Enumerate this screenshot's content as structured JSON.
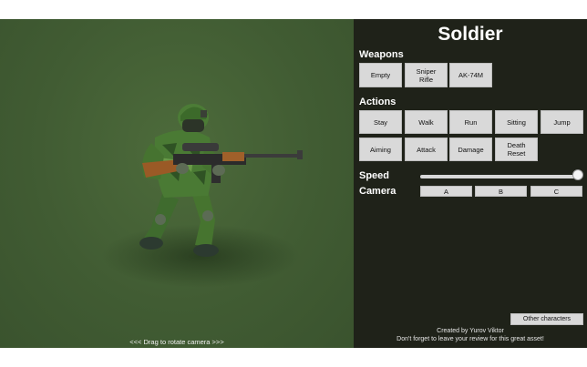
{
  "viewport": {
    "drag_hint": "<<< Drag to rotate camera >>>"
  },
  "panel": {
    "title": "Soldier",
    "weapons_label": "Weapons",
    "weapons": [
      "Empty",
      "Sniper\nRifle",
      "AK-74M"
    ],
    "actions_label": "Actions",
    "actions_row1": [
      "Stay",
      "Walk",
      "Run",
      "Sitting",
      "Jump"
    ],
    "actions_row2": [
      "Aiming",
      "Attack",
      "Damage",
      "Death\nReset"
    ],
    "speed_label": "Speed",
    "speed_value": 1.0,
    "camera_label": "Camera",
    "camera_buttons": [
      "A",
      "B",
      "C"
    ],
    "other_characters": "Other characters",
    "credit_line1": "Created by Yurov Viktor",
    "credit_line2": "Don't forget to leave your review for this great asset!"
  },
  "colors": {
    "scene_bg": "#415c33",
    "panel_bg": "#1f2219",
    "button_bg": "#d9d9d9"
  }
}
